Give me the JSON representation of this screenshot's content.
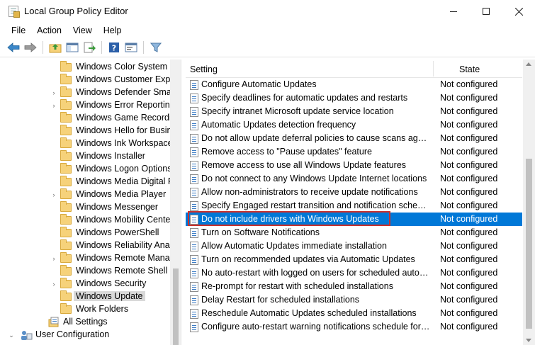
{
  "window": {
    "title": "Local Group Policy Editor",
    "minimize_icon": "minimize-icon",
    "maximize_icon": "maximize-icon",
    "close_icon": "close-icon"
  },
  "menu": [
    "File",
    "Action",
    "View",
    "Help"
  ],
  "toolbar": [
    "back-icon",
    "forward-icon",
    "up-folder-icon",
    "show-hide-tree-icon",
    "export-list-icon",
    "help-icon",
    "properties-icon",
    "filter-icon"
  ],
  "tree": {
    "items": [
      {
        "label": "Windows Color System",
        "expandable": false
      },
      {
        "label": "Windows Customer Experience Improvement Program",
        "expandable": false
      },
      {
        "label": "Windows Defender SmartScreen",
        "expandable": true
      },
      {
        "label": "Windows Error Reporting",
        "expandable": true
      },
      {
        "label": "Windows Game Recording and Broadcasting",
        "expandable": false
      },
      {
        "label": "Windows Hello for Business",
        "expandable": false
      },
      {
        "label": "Windows Ink Workspace",
        "expandable": false
      },
      {
        "label": "Windows Installer",
        "expandable": false
      },
      {
        "label": "Windows Logon Options",
        "expandable": false
      },
      {
        "label": "Windows Media Digital Rights Management",
        "expandable": false
      },
      {
        "label": "Windows Media Player",
        "expandable": true
      },
      {
        "label": "Windows Messenger",
        "expandable": false
      },
      {
        "label": "Windows Mobility Center",
        "expandable": false
      },
      {
        "label": "Windows PowerShell",
        "expandable": false
      },
      {
        "label": "Windows Reliability Analysis",
        "expandable": false
      },
      {
        "label": "Windows Remote Management",
        "expandable": true
      },
      {
        "label": "Windows Remote Shell",
        "expandable": false
      },
      {
        "label": "Windows Security",
        "expandable": true
      },
      {
        "label": "Windows Update",
        "expandable": false,
        "selected": true
      },
      {
        "label": "Work Folders",
        "expandable": false
      }
    ],
    "all_settings": "All Settings",
    "user_configuration": "User Configuration"
  },
  "list": {
    "columns": {
      "setting": "Setting",
      "state": "State"
    },
    "rows": [
      {
        "setting": "Configure Automatic Updates",
        "state": "Not configured"
      },
      {
        "setting": "Specify deadlines for automatic updates and restarts",
        "state": "Not configured"
      },
      {
        "setting": "Specify intranet Microsoft update service location",
        "state": "Not configured"
      },
      {
        "setting": "Automatic Updates detection frequency",
        "state": "Not configured"
      },
      {
        "setting": "Do not allow update deferral policies to cause scans against ...",
        "state": "Not configured"
      },
      {
        "setting": "Remove access to \"Pause updates\" feature",
        "state": "Not configured"
      },
      {
        "setting": "Remove access to use all Windows Update features",
        "state": "Not configured"
      },
      {
        "setting": "Do not connect to any Windows Update Internet locations",
        "state": "Not configured"
      },
      {
        "setting": "Allow non-administrators to receive update notifications",
        "state": "Not configured"
      },
      {
        "setting": "Specify Engaged restart transition and notification schedule f...",
        "state": "Not configured"
      },
      {
        "setting": "Do not include drivers with Windows Updates",
        "state": "Not configured",
        "selected": true
      },
      {
        "setting": "Turn on Software Notifications",
        "state": "Not configured"
      },
      {
        "setting": "Allow Automatic Updates immediate installation",
        "state": "Not configured"
      },
      {
        "setting": "Turn on recommended updates via Automatic Updates",
        "state": "Not configured"
      },
      {
        "setting": "No auto-restart with logged on users for scheduled automati...",
        "state": "Not configured"
      },
      {
        "setting": "Re-prompt for restart with scheduled installations",
        "state": "Not configured"
      },
      {
        "setting": "Delay Restart for scheduled installations",
        "state": "Not configured"
      },
      {
        "setting": "Reschedule Automatic Updates scheduled installations",
        "state": "Not configured"
      },
      {
        "setting": "Configure auto-restart warning notifications schedule for up...",
        "state": "Not configured"
      }
    ]
  },
  "colors": {
    "selection": "#0078d7",
    "highlight_box": "#c9302c",
    "folder": "#f6d27a"
  }
}
